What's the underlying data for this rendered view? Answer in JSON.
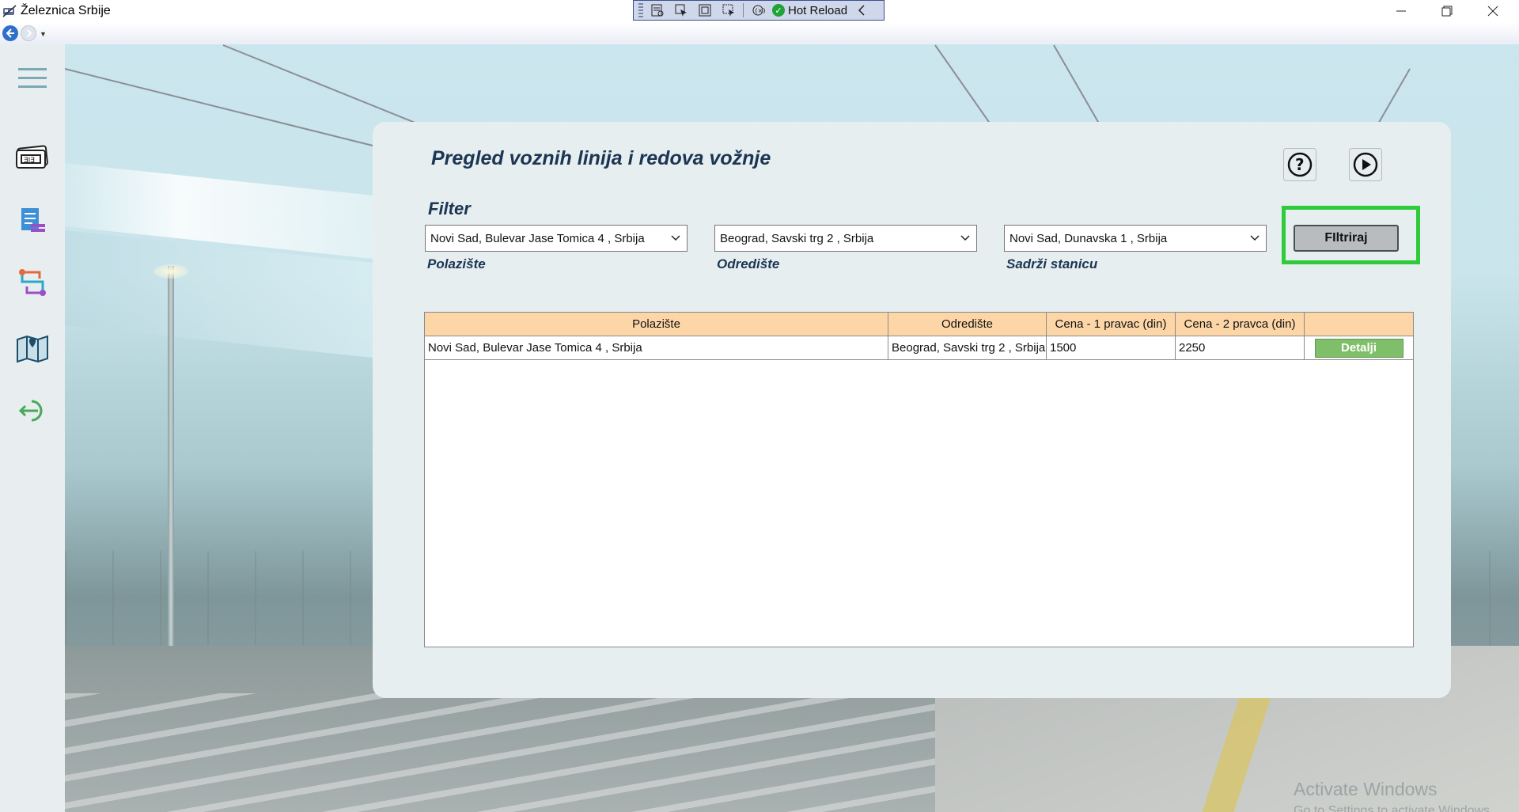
{
  "window": {
    "title": "Železnica Srbije",
    "hot_reload_label": "Hot Reload"
  },
  "sidebar": {
    "items": [
      {
        "icon": "hamburger-menu-icon"
      },
      {
        "icon": "ticket-icon"
      },
      {
        "icon": "timetable-list-icon"
      },
      {
        "icon": "route-icon"
      },
      {
        "icon": "map-icon"
      },
      {
        "icon": "logout-icon"
      }
    ]
  },
  "page": {
    "title": "Pregled voznih linija i redova vožnje",
    "filter_label": "Filter",
    "filters": {
      "departure": {
        "value": "Novi Sad, Bulevar Jase Tomica 4 , Srbija",
        "label": "Polazište"
      },
      "destination": {
        "value": "Beograd, Savski trg 2 , Srbija",
        "label": "Odredište"
      },
      "contains_station": {
        "value": "Novi Sad, Dunavska 1 , Srbija",
        "label": "Sadrži stanicu"
      }
    },
    "filter_button": "FIltriraj"
  },
  "table": {
    "columns": [
      "Polazište",
      "Odredište",
      "Cena - 1 pravac (din)",
      "Cena - 2 pravca (din)",
      ""
    ],
    "rows": [
      {
        "departure": "Novi Sad, Bulevar Jase Tomica 4 , Srbija",
        "destination": "Beograd, Savski trg 2 , Srbija",
        "price_one_way": "1500",
        "price_return": "2250",
        "action": "Detalji"
      }
    ]
  },
  "watermark": {
    "line1": "Activate Windows",
    "line2": "Go to Settings to activate Windows."
  },
  "colors": {
    "accent_highlight": "#2ecc3a",
    "header_bg": "#fdd6a8",
    "details_button": "#7fbf6a",
    "title_text": "#1b3553"
  }
}
